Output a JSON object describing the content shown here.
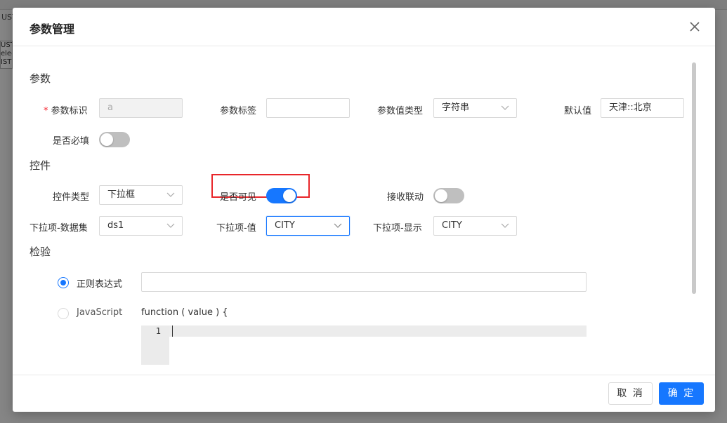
{
  "background": {
    "tab_label": "USTO",
    "strip_lines": [
      "USTO",
      "elec",
      "ISTO"
    ]
  },
  "modal": {
    "title": "参数管理",
    "close_icon": "close-icon"
  },
  "param_section": {
    "title": "参数",
    "id_label": "参数标识",
    "id_required_mark": "*",
    "id_value": "a",
    "tag_label": "参数标签",
    "tag_value": "",
    "value_type_label": "参数值类型",
    "value_type_value": "字符串",
    "default_label": "默认值",
    "default_value": "天津::北京",
    "required_label": "是否必填",
    "required_on": false
  },
  "control_section": {
    "title": "控件",
    "type_label": "控件类型",
    "type_value": "下拉框",
    "visible_label": "是否可见",
    "visible_on": true,
    "linkage_label": "接收联动",
    "linkage_on": false,
    "dataset_label": "下拉项-数据集",
    "dataset_value": "ds1",
    "option_value_label": "下拉项-值",
    "option_value_value": "CITY",
    "option_display_label": "下拉项-显示",
    "option_display_value": "CITY"
  },
  "validation_section": {
    "title": "检验",
    "regex_label": "正则表达式",
    "regex_checked": true,
    "regex_value": "",
    "js_label": "JavaScript",
    "js_checked": false,
    "js_signature": "function ( value ) {",
    "editor_line_numbers": [
      "1"
    ]
  },
  "footer": {
    "cancel_label": "取 消",
    "ok_label": "确 定"
  },
  "colors": {
    "primary": "#1677ff",
    "highlight_border": "#e8262a",
    "switch_off": "#bfbfbf"
  }
}
